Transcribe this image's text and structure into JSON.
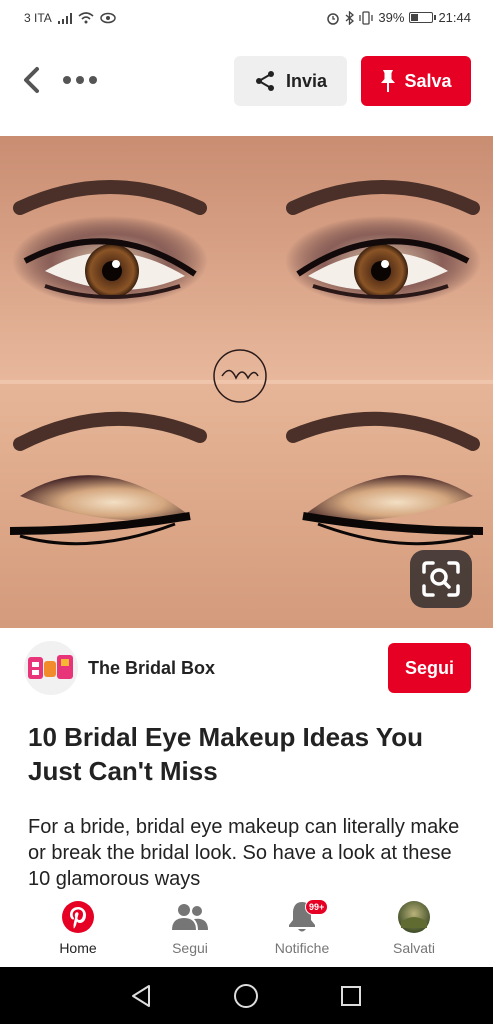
{
  "status_bar": {
    "carrier": "3 ITA",
    "battery_percent": "39%",
    "battery_level": 0.39,
    "time": "21:44"
  },
  "top_bar": {
    "share_label": "Invia",
    "save_label": "Salva"
  },
  "creator": {
    "name": "The Bridal Box",
    "follow_label": "Segui"
  },
  "pin": {
    "title": "10 Bridal Eye Makeup Ideas You Just Can't Miss",
    "description": "For a bride, bridal eye makeup can literally make or break the bridal look. So have a look at these 10 glamorous ways"
  },
  "bottom_nav": {
    "items": [
      {
        "label": "Home",
        "icon": "pinterest-logo-icon",
        "active": true
      },
      {
        "label": "Segui",
        "icon": "people-icon",
        "active": false
      },
      {
        "label": "Notifiche",
        "icon": "bell-icon",
        "active": false,
        "badge": "99+"
      },
      {
        "label": "Salvati",
        "icon": "profile-avatar",
        "active": false
      }
    ]
  },
  "colors": {
    "brand_red": "#e60023",
    "button_gray": "#efefef"
  }
}
